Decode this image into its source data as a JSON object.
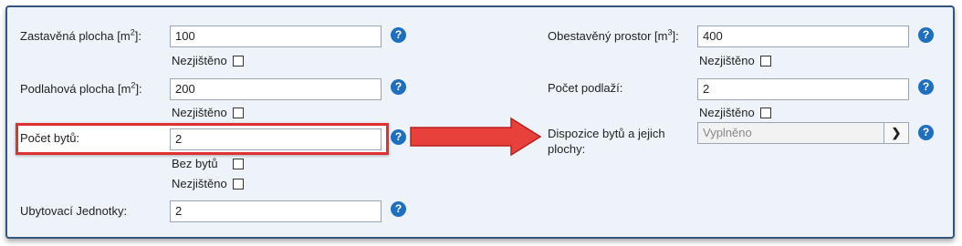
{
  "fields": {
    "zastavena": {
      "label": "Zastavěná plocha [m",
      "sup": "2",
      "suffix": "]:",
      "value": "100",
      "unknown_label": "Nezjištěno"
    },
    "podlahova": {
      "label": "Podlahová plocha [m",
      "sup": "2",
      "suffix": "]:",
      "value": "200",
      "unknown_label": "Nezjištěno"
    },
    "pocet_bytu": {
      "label": "Počet bytů:",
      "value": "2",
      "no_flats_label": "Bez bytů",
      "unknown_label": "Nezjištěno"
    },
    "ubytovaci": {
      "label": "Ubytovací Jednotky:",
      "value": "2"
    },
    "obestaveny": {
      "label": "Obestavěný prostor [m",
      "sup": "3",
      "suffix": "]:",
      "value": "400",
      "unknown_label": "Nezjištěno"
    },
    "pocet_podlazi": {
      "label": "Počet podlaží:",
      "value": "2",
      "unknown_label": "Nezjištěno"
    },
    "dispozice": {
      "label_line1": "Dispozice bytů a jejich",
      "label_line2": "plochy:",
      "value": "Vyplněno",
      "go_glyph": "❯"
    }
  },
  "help_glyph": "?",
  "colors": {
    "help": "#1e6fc0",
    "highlight": "#e03131",
    "arrow": "#e8413c",
    "border": "#33557d"
  },
  "icons": {
    "help": "question-circle-icon",
    "arrow": "red-arrow-right-icon",
    "go": "chevron-right-icon"
  }
}
